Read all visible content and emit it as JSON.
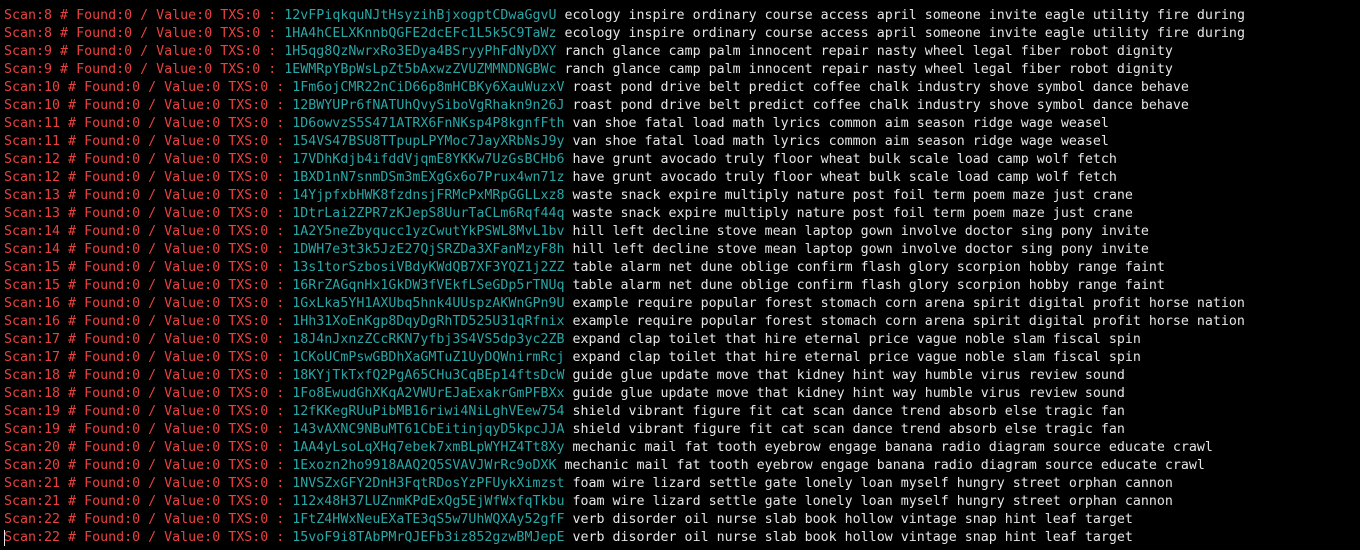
{
  "colors": {
    "background": "#000000",
    "label_red": "#e8423f",
    "address_teal": "#2aa6a6",
    "phrase_white": "#e6e6e6"
  },
  "labels": {
    "found": " # Found:",
    "value": " / Value:",
    "txs": " TXS:",
    "sep": " : "
  },
  "lines": [
    {
      "scan": "Scan:8",
      "found": "0",
      "value": "0",
      "txs": "0",
      "address": "12vFPiqkquNJtHsyzihBjxogptCDwaGgvU",
      "phrase": "ecology inspire ordinary course access april someone invite eagle utility fire during"
    },
    {
      "scan": "Scan:8",
      "found": "0",
      "value": "0",
      "txs": "0",
      "address": "1HA4hCELXKnnbQGFE2dcEFc1L5k5C9TaWz",
      "phrase": "ecology inspire ordinary course access april someone invite eagle utility fire during"
    },
    {
      "scan": "Scan:9",
      "found": "0",
      "value": "0",
      "txs": "0",
      "address": "1H5qg8QzNwrxRo3EDya4BSryyPhFdNyDXY",
      "phrase": "ranch glance camp palm innocent repair nasty wheel legal fiber robot dignity"
    },
    {
      "scan": "Scan:9",
      "found": "0",
      "value": "0",
      "txs": "0",
      "address": "1EWMRpYBpWsLpZt5bAxwzZVUZMMNDNGBWc",
      "phrase": "ranch glance camp palm innocent repair nasty wheel legal fiber robot dignity"
    },
    {
      "scan": "Scan:10",
      "found": "0",
      "value": "0",
      "txs": "0",
      "address": "1Fm6ojCMR22nCiD66p8mHCBKy6XauWuzxV",
      "phrase": "roast pond drive belt predict coffee chalk industry shove symbol dance behave"
    },
    {
      "scan": "Scan:10",
      "found": "0",
      "value": "0",
      "txs": "0",
      "address": "12BWYUPr6fNATUhQvySiboVgRhakn9n26J",
      "phrase": "roast pond drive belt predict coffee chalk industry shove symbol dance behave"
    },
    {
      "scan": "Scan:11",
      "found": "0",
      "value": "0",
      "txs": "0",
      "address": "1D6owvzS5S471ATRX6FnNKsp4P8kgnfFth",
      "phrase": "van shoe fatal load math lyrics common aim season ridge wage weasel"
    },
    {
      "scan": "Scan:11",
      "found": "0",
      "value": "0",
      "txs": "0",
      "address": "154VS47BSU8TTpupLPYMoc7JayXRbNsJ9y",
      "phrase": "van shoe fatal load math lyrics common aim season ridge wage weasel"
    },
    {
      "scan": "Scan:12",
      "found": "0",
      "value": "0",
      "txs": "0",
      "address": "17VDhKdjb4ifddVjqmE8YKKw7UzGsBCHb6",
      "phrase": "have grunt avocado truly floor wheat bulk scale load camp wolf fetch"
    },
    {
      "scan": "Scan:12",
      "found": "0",
      "value": "0",
      "txs": "0",
      "address": "1BXD1nN7snmDSm3mEXgGx6o7Prux4wn71z",
      "phrase": "have grunt avocado truly floor wheat bulk scale load camp wolf fetch"
    },
    {
      "scan": "Scan:13",
      "found": "0",
      "value": "0",
      "txs": "0",
      "address": "14YjpfxbHWK8fzdnsjFRMcPxMRpGGLLxz8",
      "phrase": "waste snack expire multiply nature post foil term poem maze just crane"
    },
    {
      "scan": "Scan:13",
      "found": "0",
      "value": "0",
      "txs": "0",
      "address": "1DtrLai2ZPR7zKJepS8UurTaCLm6Rqf44q",
      "phrase": "waste snack expire multiply nature post foil term poem maze just crane"
    },
    {
      "scan": "Scan:14",
      "found": "0",
      "value": "0",
      "txs": "0",
      "address": "1A2Y5neZbyqucc1yzCwutYkPSWL8MvL1bv",
      "phrase": "hill left decline stove mean laptop gown involve doctor sing pony invite"
    },
    {
      "scan": "Scan:14",
      "found": "0",
      "value": "0",
      "txs": "0",
      "address": "1DWH7e3t3k5JzE27QjSRZDa3XFanMzyF8h",
      "phrase": "hill left decline stove mean laptop gown involve doctor sing pony invite"
    },
    {
      "scan": "Scan:15",
      "found": "0",
      "value": "0",
      "txs": "0",
      "address": "13s1torSzbosiVBdyKWdQB7XF3YQZ1j2ZZ",
      "phrase": "table alarm net dune oblige confirm flash glory scorpion hobby range faint"
    },
    {
      "scan": "Scan:15",
      "found": "0",
      "value": "0",
      "txs": "0",
      "address": "16RrZAGqnHx1GkDW3fVEkfLSeGDp5rTNUq",
      "phrase": "table alarm net dune oblige confirm flash glory scorpion hobby range faint"
    },
    {
      "scan": "Scan:16",
      "found": "0",
      "value": "0",
      "txs": "0",
      "address": "1GxLka5YH1AXUbq5hnk4UUspzAKWnGPn9U",
      "phrase": "example require popular forest stomach corn arena spirit digital profit horse nation"
    },
    {
      "scan": "Scan:16",
      "found": "0",
      "value": "0",
      "txs": "0",
      "address": "1Hh31XoEnKgp8DqyDgRhTD525U31qRfnix",
      "phrase": "example require popular forest stomach corn arena spirit digital profit horse nation"
    },
    {
      "scan": "Scan:17",
      "found": "0",
      "value": "0",
      "txs": "0",
      "address": "18J4nJxnzZCcRKN7yfbj3S4VS5dp3yc2ZB",
      "phrase": "expand clap toilet that hire eternal price vague noble slam fiscal spin"
    },
    {
      "scan": "Scan:17",
      "found": "0",
      "value": "0",
      "txs": "0",
      "address": "1CKoUCmPswGBDhXaGMTuZ1UyDQWnirmRcj",
      "phrase": "expand clap toilet that hire eternal price vague noble slam fiscal spin"
    },
    {
      "scan": "Scan:18",
      "found": "0",
      "value": "0",
      "txs": "0",
      "address": "18KYjTkTxfQ2PgA65CHu3CqBEp14ftsDcW",
      "phrase": "guide glue update move that kidney hint way humble virus review sound"
    },
    {
      "scan": "Scan:18",
      "found": "0",
      "value": "0",
      "txs": "0",
      "address": "1Fo8EwudGhXKqA2VWUrEJaExakrGmPFBXx",
      "phrase": "guide glue update move that kidney hint way humble virus review sound"
    },
    {
      "scan": "Scan:19",
      "found": "0",
      "value": "0",
      "txs": "0",
      "address": "12fKKegRUuPibMB16riwi4NiLghVEew754",
      "phrase": "shield vibrant figure fit cat scan dance trend absorb else tragic fan"
    },
    {
      "scan": "Scan:19",
      "found": "0",
      "value": "0",
      "txs": "0",
      "address": "143vAXNC9NBuMT61CbEitinjqyD5kpcJJA",
      "phrase": "shield vibrant figure fit cat scan dance trend absorb else tragic fan"
    },
    {
      "scan": "Scan:20",
      "found": "0",
      "value": "0",
      "txs": "0",
      "address": "1AA4yLsoLqXHq7ebek7xmBLpWYHZ4Tt8Xy",
      "phrase": "mechanic mail fat tooth eyebrow engage banana radio diagram source educate crawl"
    },
    {
      "scan": "Scan:20",
      "found": "0",
      "value": "0",
      "txs": "0",
      "address": "1Exozn2ho9918AAQ2Q5SVAVJWrRc9oDXK",
      "phrase": "mechanic mail fat tooth eyebrow engage banana radio diagram source educate crawl"
    },
    {
      "scan": "Scan:21",
      "found": "0",
      "value": "0",
      "txs": "0",
      "address": "1NVSZxGFY2DnH3FqtRDosYzPFUykXimzst",
      "phrase": "foam wire lizard settle gate lonely loan myself hungry street orphan cannon"
    },
    {
      "scan": "Scan:21",
      "found": "0",
      "value": "0",
      "txs": "0",
      "address": "112x48H37LUZnmKPdExQg5EjWfWxfqTkbu",
      "phrase": "foam wire lizard settle gate lonely loan myself hungry street orphan cannon"
    },
    {
      "scan": "Scan:22",
      "found": "0",
      "value": "0",
      "txs": "0",
      "address": "1FtZ4HWxNeuEXaTE3qS5w7UhWQXAy52gfF",
      "phrase": "verb disorder oil nurse slab book hollow vintage snap hint leaf target"
    },
    {
      "scan": "Scan:22",
      "found": "0",
      "value": "0",
      "txs": "0",
      "address": "15voF9i8TAbPMrQJEFb3iz852gzwBMJepE",
      "phrase": "verb disorder oil nurse slab book hollow vintage snap hint leaf target"
    }
  ]
}
